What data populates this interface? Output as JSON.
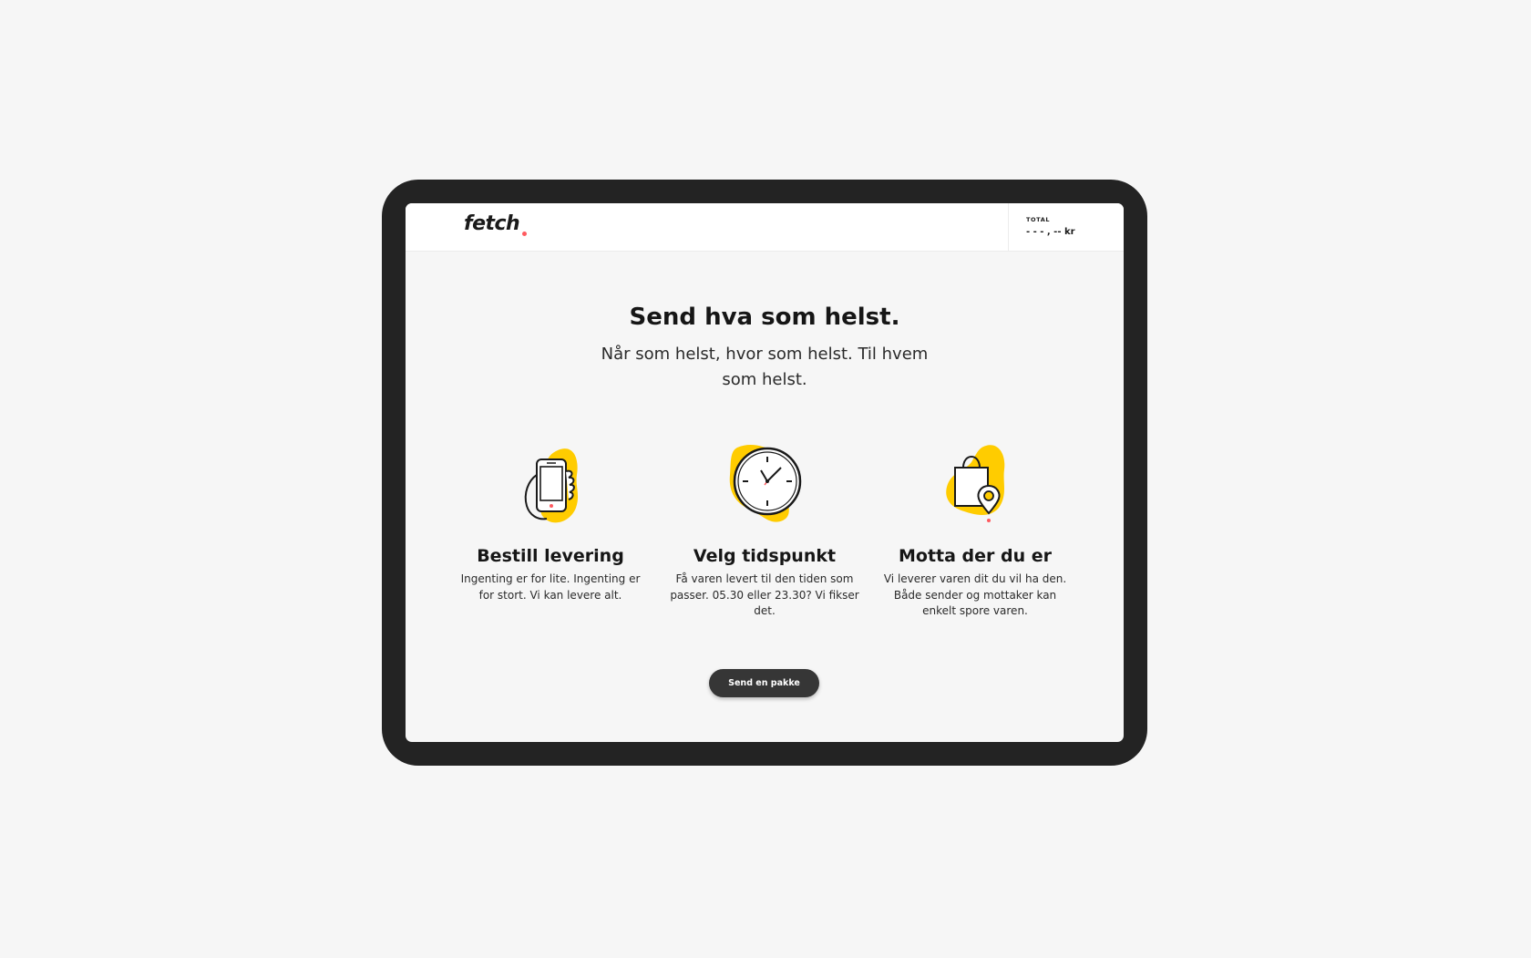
{
  "app": {
    "logo_text": "fetch",
    "accent_color": "#ffcc00",
    "dot_color": "#ff5a5f",
    "button_color": "#363636"
  },
  "header": {
    "total_label": "TOTAL",
    "total_value": "- - - , -- kr"
  },
  "hero": {
    "title": "Send hva som helst.",
    "subtitle": "Når som helst, hvor som helst. Til hvem som helst."
  },
  "features": [
    {
      "icon": "phone-in-hand-icon",
      "title": "Bestill levering",
      "text": "Ingenting er for lite. Ingenting er for stort. Vi kan levere alt."
    },
    {
      "icon": "clock-icon",
      "title": "Velg tidspunkt",
      "text": "Få varen levert til den tiden som passer. 05.30 eller 23.30? Vi fikser det."
    },
    {
      "icon": "bag-location-icon",
      "title": "Motta der du er",
      "text": "Vi leverer varen dit du vil ha den. Både sender og mottaker kan enkelt spore varen."
    }
  ],
  "cta": {
    "label": "Send en pakke"
  }
}
